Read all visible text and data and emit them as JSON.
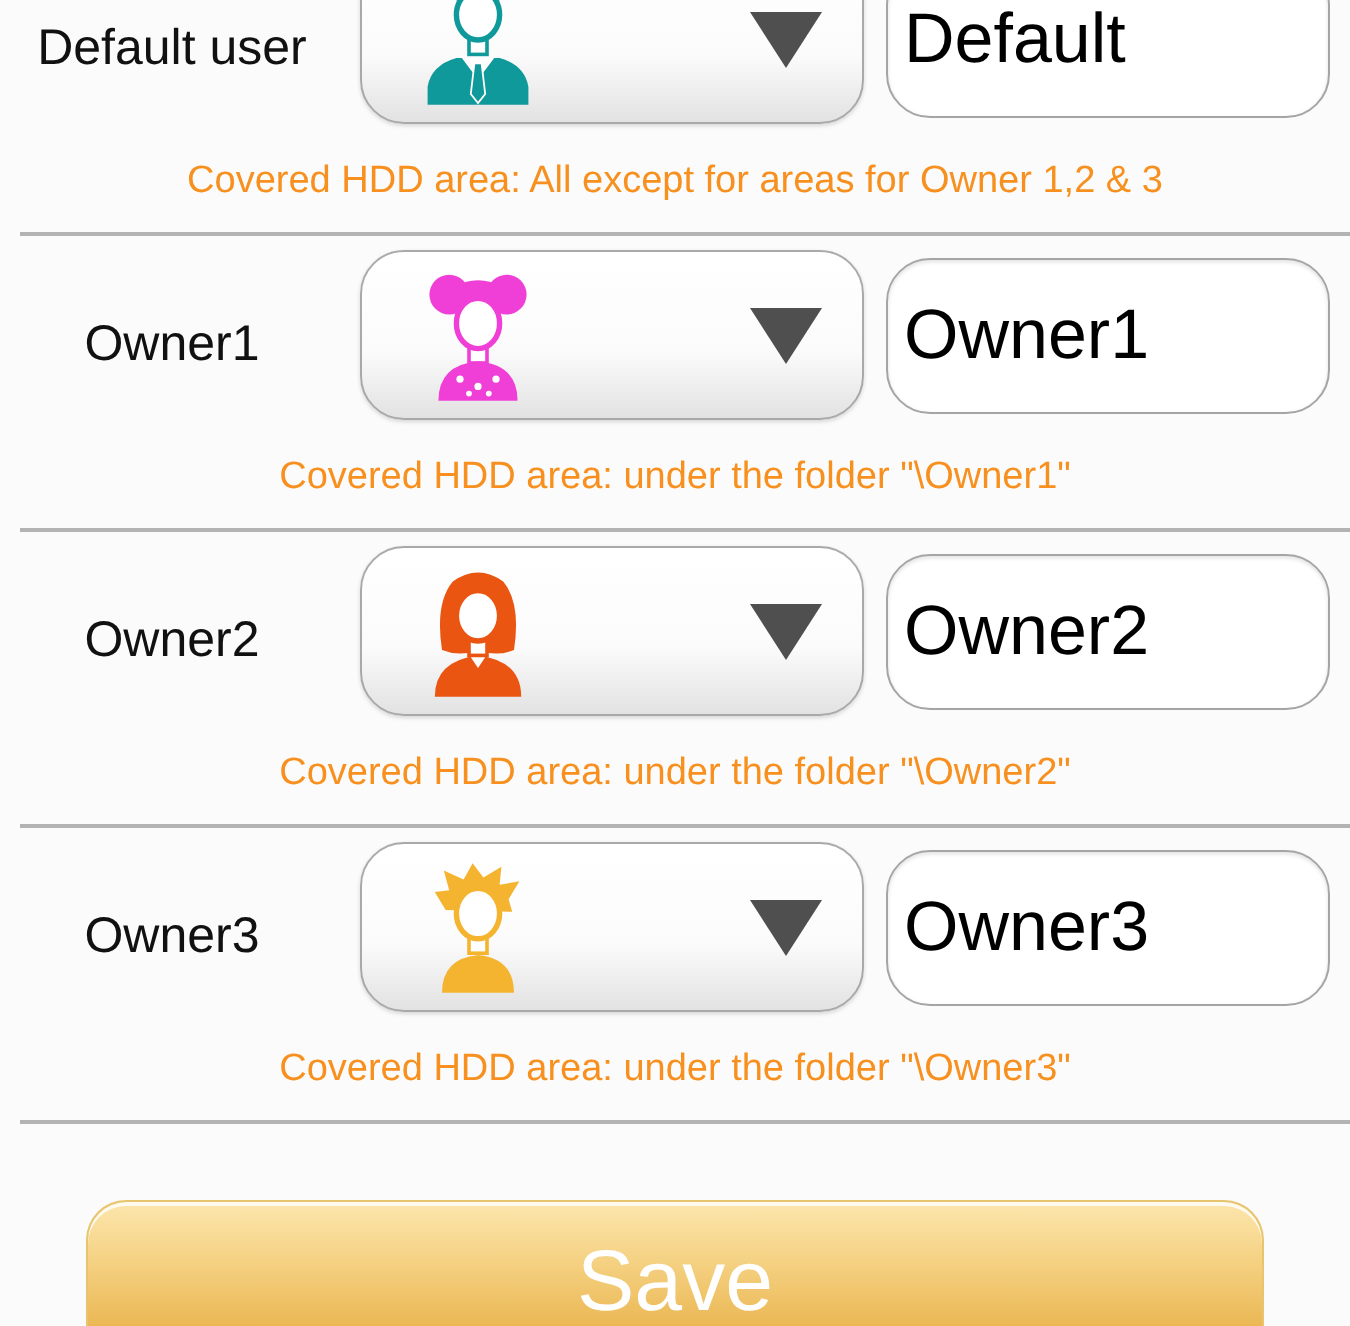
{
  "users": [
    {
      "label": "Default user",
      "kind": "man",
      "color": "#10999a",
      "value": "Default",
      "note": "Covered HDD area: All except for areas for Owner 1,2 & 3"
    },
    {
      "label": "Owner1",
      "kind": "girl",
      "color": "#f03fd6",
      "value": "Owner1",
      "note": "Covered HDD area: under the folder \"\\Owner1\""
    },
    {
      "label": "Owner2",
      "kind": "woman",
      "color": "#ea5512",
      "value": "Owner2",
      "note": "Covered HDD area: under the folder \"\\Owner2\""
    },
    {
      "label": "Owner3",
      "kind": "boy",
      "color": "#f5b430",
      "value": "Owner3",
      "note": "Covered HDD area: under the folder \"\\Owner3\""
    }
  ],
  "save_button": {
    "label": "Save"
  }
}
